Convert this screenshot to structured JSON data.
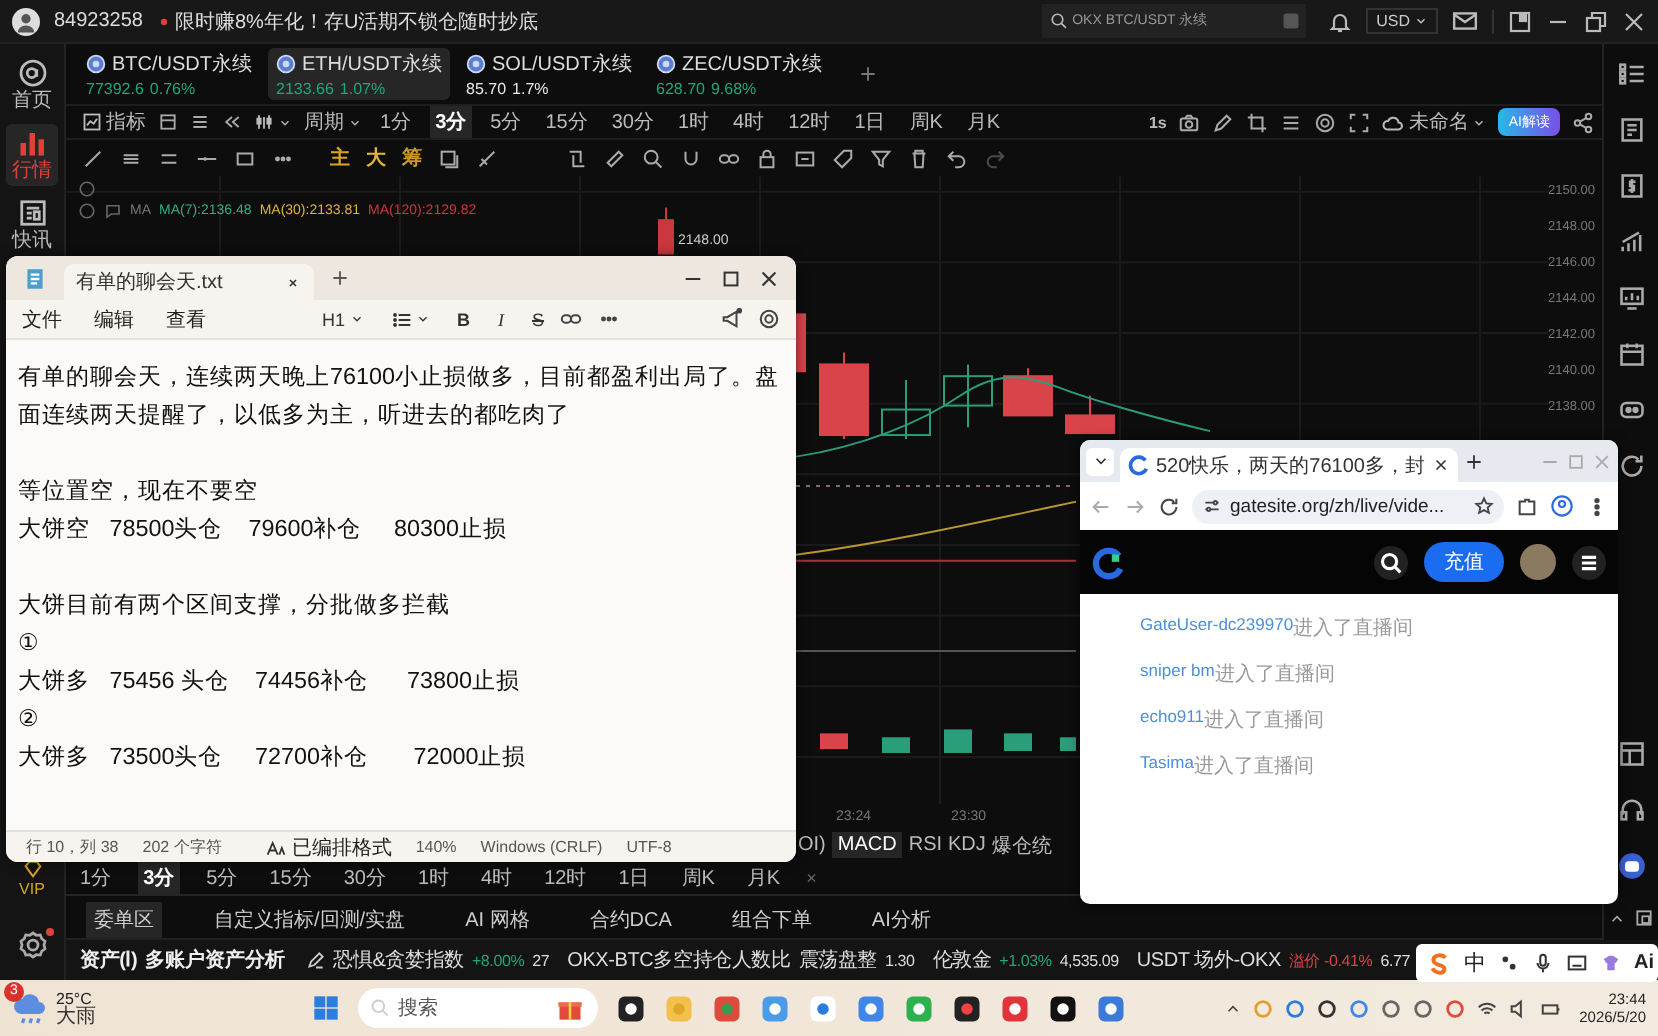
{
  "top_bar": {
    "account": "84923258",
    "promo": "限时赚8%年化！存U活期不锁仓随时抄底",
    "search": {
      "placeholder": "OKX BTC/USDT 永续"
    },
    "currency": "USD"
  },
  "left_nav": {
    "items": [
      {
        "label": "首页",
        "selected": false
      },
      {
        "label": "行情",
        "selected": true
      },
      {
        "label": "快讯",
        "selected": false
      }
    ],
    "vip": "VIP"
  },
  "market_tabs": [
    {
      "pair": "BTC/USDT永续",
      "price": "77392.6",
      "change": "0.76%",
      "color": "#1fa77a",
      "selected": false
    },
    {
      "pair": "ETH/USDT永续",
      "price": "2133.66",
      "change": "1.07%",
      "color": "#1fa77a",
      "selected": true
    },
    {
      "pair": "SOL/USDT永续",
      "price": "85.70",
      "change": "1.7%",
      "color": "#e8e8e8",
      "selected": false
    },
    {
      "pair": "ZEC/USDT永续",
      "price": "628.70",
      "change": "9.68%",
      "color": "#1fa77a",
      "selected": false
    }
  ],
  "toolbar": {
    "indicator": "指标",
    "period": "周期",
    "intervals": [
      {
        "label": "1分",
        "selected": false
      },
      {
        "label": "3分",
        "selected": true
      },
      {
        "label": "5分",
        "selected": false
      },
      {
        "label": "15分",
        "selected": false
      },
      {
        "label": "30分",
        "selected": false
      },
      {
        "label": "1时",
        "selected": false
      },
      {
        "label": "4时",
        "selected": false
      },
      {
        "label": "12时",
        "selected": false
      },
      {
        "label": "1日",
        "selected": false
      },
      {
        "label": "周K",
        "selected": false
      },
      {
        "label": "月K",
        "selected": false
      }
    ],
    "refresh": "1s",
    "layout": "未命名",
    "ai_button": "AI解读"
  },
  "drawing_toolbar": {
    "labels": [
      "主",
      "大",
      "筹"
    ]
  },
  "chart": {
    "legend_label": "MA",
    "legend": [
      {
        "text": "MA(7):2136.48",
        "color": "#2fae8a"
      },
      {
        "text": "MA(30):2133.81",
        "color": "#e0b23a"
      },
      {
        "text": "MA(120):2129.82",
        "color": "#c8383c"
      }
    ],
    "price_tag": "2148.00",
    "price_axis": [
      "2150.00",
      "2148.00",
      "2146.00",
      "2144.00",
      "2142.00",
      "2140.00",
      "2138.00"
    ],
    "time_axis": [
      "23:24",
      "23:30"
    ]
  },
  "indicator_tabs": [
    {
      "label": "OI)",
      "selected": false
    },
    {
      "label": "MACD",
      "selected": true
    },
    {
      "label": "RSI",
      "selected": false
    },
    {
      "label": "KDJ",
      "selected": false
    },
    {
      "label": "爆仓统",
      "selected": false
    }
  ],
  "bottom_intervals": {
    "intervals": [
      {
        "label": "1分",
        "selected": false
      },
      {
        "label": "3分",
        "selected": true
      },
      {
        "label": "5分",
        "selected": false
      },
      {
        "label": "15分",
        "selected": false
      },
      {
        "label": "30分",
        "selected": false
      },
      {
        "label": "1时",
        "selected": false
      },
      {
        "label": "4时",
        "selected": false
      },
      {
        "label": "12时",
        "selected": false
      },
      {
        "label": "1日",
        "selected": false
      },
      {
        "label": "周K",
        "selected": false
      },
      {
        "label": "月K",
        "selected": false
      }
    ],
    "close": "×"
  },
  "bottom_tabs": [
    {
      "label": "委单区",
      "selected": true
    },
    {
      "label": "自定义指标/回测/实盘",
      "selected": false
    },
    {
      "label": "AI 网格",
      "selected": false
    },
    {
      "label": "合约DCA",
      "selected": false
    },
    {
      "label": "组合下单",
      "selected": false
    },
    {
      "label": "AI分析",
      "selected": false
    }
  ],
  "ticker": {
    "assets": "资产(Ⅰ)",
    "analysis": "多账户资产分析",
    "items": [
      {
        "name": "恐惧&贪婪指数",
        "change": "+8.00%",
        "color": "#1fa77a",
        "value": "27"
      },
      {
        "name": "OKX-BTC多空持仓人数比",
        "tag": "震荡盘整",
        "value": "1.30"
      },
      {
        "name": "伦敦金",
        "change": "+1.03%",
        "color": "#1fa77a",
        "value": "4,535.09"
      },
      {
        "name": "USDT 场外-OKX",
        "change": "溢价 -0.41%",
        "color": "#d9434a",
        "value": "6.77"
      }
    ]
  },
  "notepad": {
    "tab_title": "有单的聊会天.txt",
    "menu": [
      "文件",
      "编辑",
      "查看"
    ],
    "heading": "H1",
    "format_buttons": [
      {
        "label": "B",
        "kind": "bold"
      },
      {
        "label": "I",
        "kind": "italic"
      },
      {
        "label": "S",
        "kind": "strike"
      }
    ],
    "blocks": [
      {
        "lines": [
          "有单的聊会天，连续两天晚上76100小止损做多，目前都盈利出局了。盘面连续两天提醒了，以低多为主，听进去的都吃肉了"
        ]
      },
      {
        "lines": [
          "等位置空，现在不要空",
          "大饼空   78500头仓    79600补仓     80300止损"
        ]
      },
      {
        "lines": [
          "大饼目前有两个区间支撑，分批做多拦截",
          "①",
          "大饼多   75456 头仓    74456补仓      73800止损",
          "②",
          "大饼多   73500头仓     72700补仓       72000止损"
        ]
      }
    ],
    "status": {
      "position": "行 10，列 38",
      "chars": "202 个字符",
      "format": "已编排格式",
      "zoom": "140%",
      "line_endings": "Windows (CRLF)",
      "encoding": "UTF-8"
    }
  },
  "browser": {
    "tab_title": "520快乐，两天的76100多，封",
    "url": "gatesite.org/zh/live/vide...",
    "deposit_button": "充值",
    "messages": [
      {
        "user": "GateUser-dc239970",
        "text": "进入了直播间"
      },
      {
        "user": "sniper bm",
        "text": "进入了直播间"
      },
      {
        "user": "echo911",
        "text": "进入了直播间"
      },
      {
        "user": "Tasima",
        "text": "进入了直播间"
      }
    ]
  },
  "ime_bar": {
    "mode": "中",
    "ai": "Ai"
  },
  "taskbar": {
    "weather": {
      "badge": "3",
      "temperature": "25°C",
      "condition": "大雨"
    },
    "search": {
      "placeholder": "搜索"
    },
    "clock": {
      "time": "23:44",
      "date": "2026/5/20"
    }
  }
}
